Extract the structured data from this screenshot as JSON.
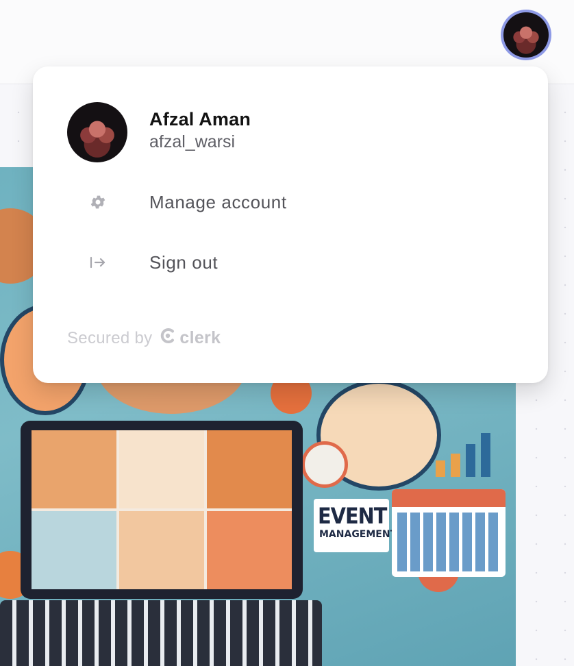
{
  "user": {
    "display_name": "Afzal Aman",
    "username": "afzal_warsi"
  },
  "menu": {
    "items": [
      {
        "label": "Manage account",
        "icon": "gear-icon"
      },
      {
        "label": "Sign out",
        "icon": "sign-out-icon"
      }
    ]
  },
  "footer": {
    "secured_by": "Secured by",
    "brand": "clerk",
    "brand_icon": "clerk-logo-icon"
  },
  "hero": {
    "event_title": "EVENT",
    "event_subtitle": "MANAGEMENT"
  },
  "colors": {
    "avatar_ring": "#8e9ae6",
    "popover_bg": "#ffffff",
    "hero_bg": "#6fb2c0",
    "accent_orange": "#e06a4a"
  }
}
